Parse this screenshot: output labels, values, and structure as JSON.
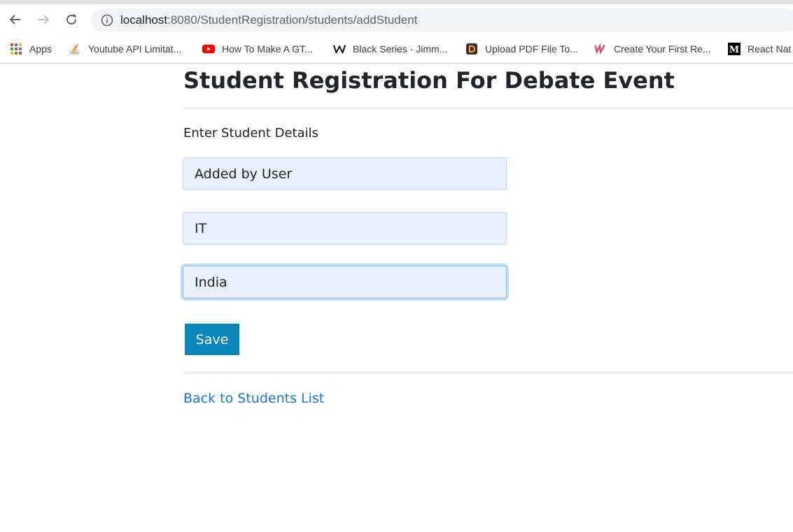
{
  "browser": {
    "url_host": "localhost",
    "url_path": ":8080/StudentRegistration/students/addStudent",
    "back_icon": "arrow-left-icon",
    "forward_icon": "arrow-right-icon",
    "reload_icon": "reload-icon",
    "info_icon": "info-icon"
  },
  "bookmarks": [
    {
      "label": "Apps",
      "icon": "apps-grid-icon"
    },
    {
      "label": "Youtube API Limitat...",
      "icon": "stack-overflow-icon"
    },
    {
      "label": "How To Make A GT...",
      "icon": "youtube-icon"
    },
    {
      "label": "Black Series - Jimm...",
      "icon": "w-logo-icon"
    },
    {
      "label": "Upload PDF File To...",
      "icon": "d-logo-icon"
    },
    {
      "label": "Create Your First Re...",
      "icon": "u-logo-icon"
    },
    {
      "label": "React Nat",
      "icon": "medium-icon"
    }
  ],
  "page": {
    "title": "Student Registration For Debate Event",
    "subtitle": "Enter Student Details",
    "fields": [
      {
        "value": "Added by User"
      },
      {
        "value": "IT"
      },
      {
        "value": "India"
      }
    ],
    "save_label": "Save",
    "back_link": "Back to Students List"
  },
  "colors": {
    "save_button": "#0a87b8",
    "link": "#1a73e8",
    "field_bg": "#e8f0fe"
  }
}
